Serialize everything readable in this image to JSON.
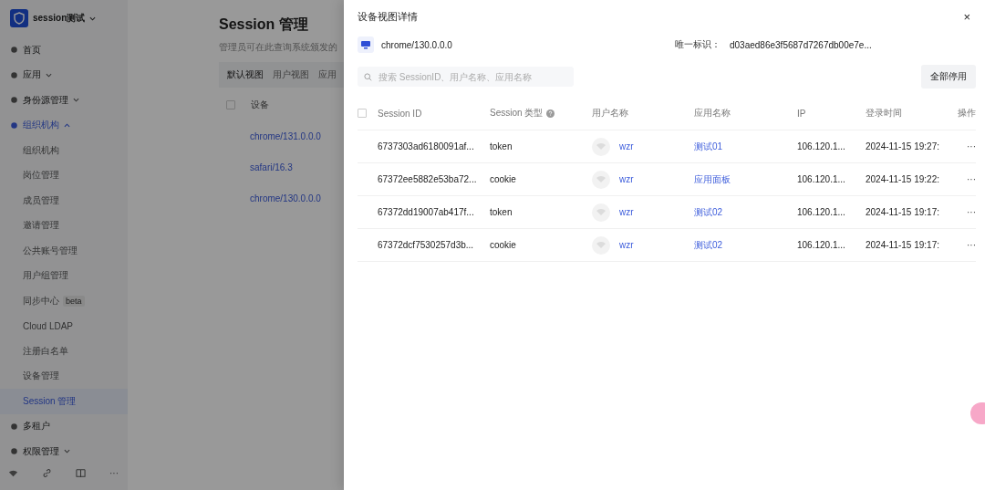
{
  "app": {
    "name": "session测试"
  },
  "sidebar": {
    "items": [
      {
        "label": "首页",
        "kind": "link",
        "selected": false
      },
      {
        "label": "应用",
        "kind": "group",
        "expanded": false,
        "selected": false
      },
      {
        "label": "身份源管理",
        "kind": "group",
        "expanded": false,
        "selected": false
      },
      {
        "label": "组织机构",
        "kind": "group",
        "expanded": true,
        "selected": true,
        "children": [
          {
            "label": "组织机构",
            "selected": false
          },
          {
            "label": "岗位管理",
            "selected": false
          },
          {
            "label": "成员管理",
            "selected": false
          },
          {
            "label": "邀请管理",
            "selected": false
          },
          {
            "label": "公共账号管理",
            "selected": false
          },
          {
            "label": "用户组管理",
            "selected": false
          },
          {
            "label": "同步中心",
            "badge": "beta",
            "selected": false
          },
          {
            "label": "Cloud LDAP",
            "selected": false
          },
          {
            "label": "注册白名单",
            "selected": false
          },
          {
            "label": "设备管理",
            "selected": false
          },
          {
            "label": "Session 管理",
            "selected": true
          }
        ]
      },
      {
        "label": "多租户",
        "kind": "link",
        "selected": false
      },
      {
        "label": "权限管理",
        "kind": "group",
        "expanded": false,
        "selected": false
      }
    ],
    "footer_more": "···"
  },
  "page": {
    "title": "Session 管理",
    "subtitle": "管理员可在此查询系统颁发的",
    "tabs": [
      {
        "label": "默认视图",
        "selected": true
      },
      {
        "label": "用户视图",
        "selected": false
      },
      {
        "label": "应用",
        "selected": false
      }
    ],
    "table": {
      "columns": [
        "设备"
      ],
      "header_checked": false,
      "rows": [
        {
          "device": "chrome/131.0.0.0"
        },
        {
          "device": "safari/16.3"
        },
        {
          "device": "chrome/130.0.0.0"
        }
      ]
    }
  },
  "drawer": {
    "title": "设备视图详情",
    "close": "×",
    "device": "chrome/130.0.0.0",
    "id_label": "唯一标识：",
    "id_value": "d03aed86e3f5687d7267db00e7e...",
    "search": {
      "placeholder": "搜索 SessionID、用户名称、应用名称"
    },
    "disable_all": "全部停用",
    "table": {
      "header_checked": false,
      "columns": [
        "Session ID",
        "Session 类型",
        "用户名称",
        "应用名称",
        "IP",
        "登录时间",
        "操作"
      ],
      "rows": [
        {
          "session_id": "6737303ad6180091af...",
          "type": "token",
          "user": "wzr",
          "app": "测试01",
          "ip": "106.120.1...",
          "time": "2024-11-15 19:27:",
          "action": "···"
        },
        {
          "session_id": "67372ee5882e53ba72...",
          "type": "cookie",
          "user": "wzr",
          "app": "应用面板",
          "ip": "106.120.1...",
          "time": "2024-11-15 19:22:",
          "action": "···"
        },
        {
          "session_id": "67372dd19007ab417f...",
          "type": "token",
          "user": "wzr",
          "app": "测试02",
          "ip": "106.120.1...",
          "time": "2024-11-15 19:17:",
          "action": "···"
        },
        {
          "session_id": "67372dcf7530257d3b...",
          "type": "cookie",
          "user": "wzr",
          "app": "测试02",
          "ip": "106.120.1...",
          "time": "2024-11-15 19:17:",
          "action": "···"
        }
      ]
    }
  }
}
